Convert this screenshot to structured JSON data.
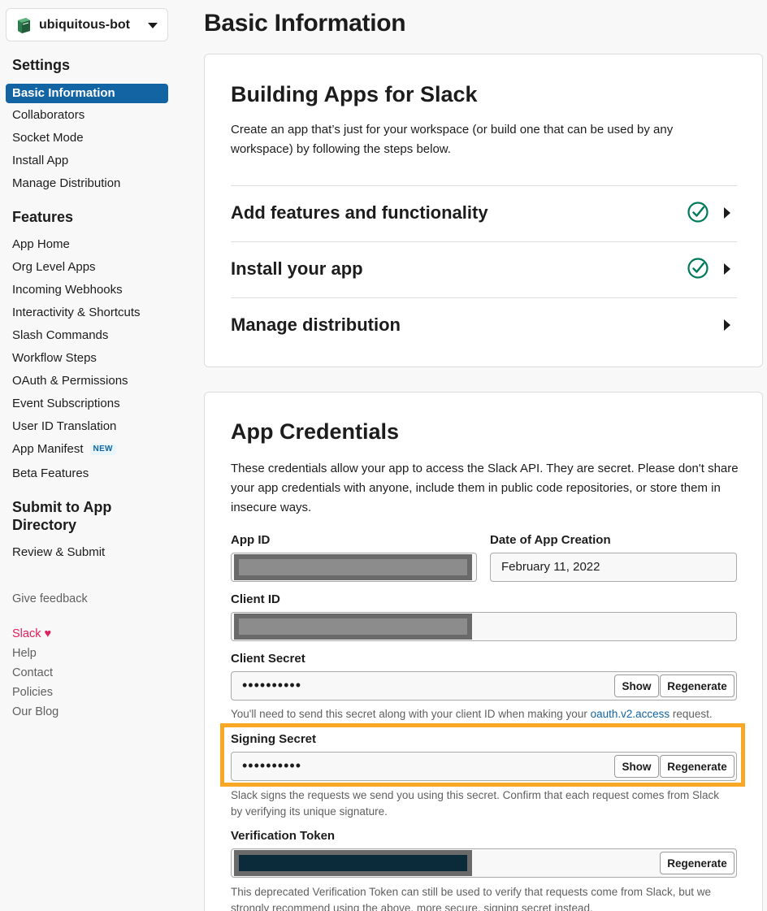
{
  "app_switcher": {
    "name": "ubiquitous-bot",
    "icon": "book-icon"
  },
  "sidebar": {
    "settings_heading": "Settings",
    "settings_items": [
      "Basic Information",
      "Collaborators",
      "Socket Mode",
      "Install App",
      "Manage Distribution"
    ],
    "features_heading": "Features",
    "features_items": [
      "App Home",
      "Org Level Apps",
      "Incoming Webhooks",
      "Interactivity & Shortcuts",
      "Slash Commands",
      "Workflow Steps",
      "OAuth & Permissions",
      "Event Subscriptions",
      "User ID Translation",
      "App Manifest",
      "Beta Features"
    ],
    "new_badge": "NEW",
    "submit_heading_line1": "Submit to App",
    "submit_heading_line2": "Directory",
    "submit_items": [
      "Review & Submit"
    ],
    "give_feedback": "Give feedback",
    "footer_slack": "Slack",
    "footer_heart": "♥",
    "footer_links": [
      "Help",
      "Contact",
      "Policies",
      "Our Blog"
    ]
  },
  "page": {
    "title": "Basic Information"
  },
  "building": {
    "title": "Building Apps for Slack",
    "description": "Create an app that’s just for your workspace (or build one that can be used by any workspace) by following the steps below.",
    "steps": [
      {
        "label": "Add features and functionality",
        "checked": true
      },
      {
        "label": "Install your app",
        "checked": true
      },
      {
        "label": "Manage distribution",
        "checked": false
      }
    ]
  },
  "credentials": {
    "title": "App Credentials",
    "description": "These credentials allow your app to access the Slack API. They are secret. Please don't share your app credentials with anyone, include them in public code repositories, or store them in insecure ways.",
    "app_id_label": "App ID",
    "date_label": "Date of App Creation",
    "date_value": "February 11, 2022",
    "client_id_label": "Client ID",
    "client_secret_label": "Client Secret",
    "client_secret_masked": "••••••••••",
    "show_label": "Show",
    "regenerate_label": "Regenerate",
    "client_secret_help_pre": "You'll need to send this secret along with your client ID when making your ",
    "client_secret_help_link": "oauth.v2.access",
    "client_secret_help_post": " request.",
    "signing_secret_label": "Signing Secret",
    "signing_secret_masked": "••••••••••",
    "signing_help": "Slack signs the requests we send you using this secret. Confirm that each request comes from Slack by verifying its unique signature.",
    "verification_label": "Verification Token",
    "verification_help": "This deprecated Verification Token can still be used to verify that requests come from Slack, but we strongly recommend using the above, more secure, signing secret instead."
  },
  "colors": {
    "accent": "#1264a3",
    "success": "#007a5a",
    "highlight": "#f9a825",
    "slack_red": "#e01e5a"
  }
}
